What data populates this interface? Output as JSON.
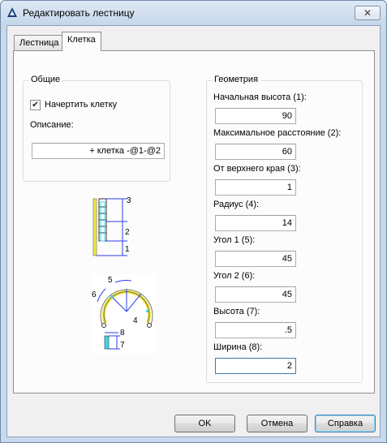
{
  "window": {
    "title": "Редактировать лестницу",
    "close_symbol": "✕"
  },
  "tabs": [
    {
      "label": "Лестница",
      "active": false
    },
    {
      "label": "Клетка",
      "active": true
    }
  ],
  "general": {
    "title": "Общие",
    "draw_cage_label": "Начертить клетку",
    "draw_cage_checked": true,
    "description_label": "Описание:",
    "description_value": "+ клетка -@1-@2"
  },
  "geometry": {
    "title": "Геометрия",
    "fields": [
      {
        "label": "Начальная высота (1):",
        "value": "90"
      },
      {
        "label": "Максимальное расстояние (2):",
        "value": "60"
      },
      {
        "label": "От верхнего края (3):",
        "value": "1"
      },
      {
        "label": "Радиус (4):",
        "value": "14"
      },
      {
        "label": "Угол 1 (5):",
        "value": "45"
      },
      {
        "label": "Угол 2 (6):",
        "value": "45"
      },
      {
        "label": "Высота (7):",
        "value": ".5"
      },
      {
        "label": "Ширина (8):",
        "value": "2"
      }
    ]
  },
  "diagram_side": {
    "labels": [
      "3",
      "2",
      "1"
    ]
  },
  "diagram_top": {
    "labels": [
      "5",
      "6",
      "4",
      "8",
      "7"
    ]
  },
  "buttons": {
    "ok": "OK",
    "cancel": "Отмена",
    "help": "Справка"
  },
  "icons": {
    "app": "autocad-triangle-icon",
    "check": "checkmark-icon"
  },
  "colors": {
    "accent_yellow": "#f3e93a",
    "dimension_blue": "#2b3cf0",
    "highlight_cyan": "#3fd6e8"
  }
}
